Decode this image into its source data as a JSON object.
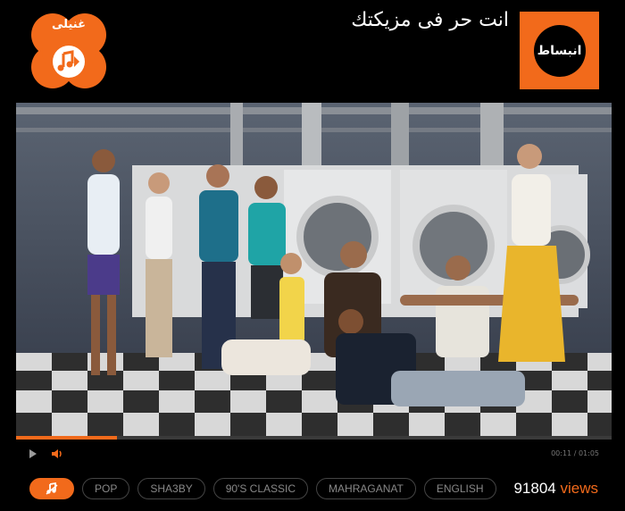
{
  "header": {
    "app_logo_text": "غنيلى",
    "tagline": "انت حر فى مزيكتك",
    "brand_text": "انبساط"
  },
  "player": {
    "current_time": "00:11",
    "separator": " / ",
    "duration": "01:05",
    "progress": 0.17
  },
  "genres": [
    "POP",
    "SHA3BY",
    "90'S CLASSIC",
    "MAHRAGANAT",
    "ENGLISH"
  ],
  "stats": {
    "views_count": "91804",
    "views_label": "views"
  },
  "colors": {
    "accent": "#f26a1b",
    "background": "#000000"
  },
  "icons": [
    "music-note-icon",
    "play-icon",
    "volume-icon",
    "shuffle-icon"
  ]
}
